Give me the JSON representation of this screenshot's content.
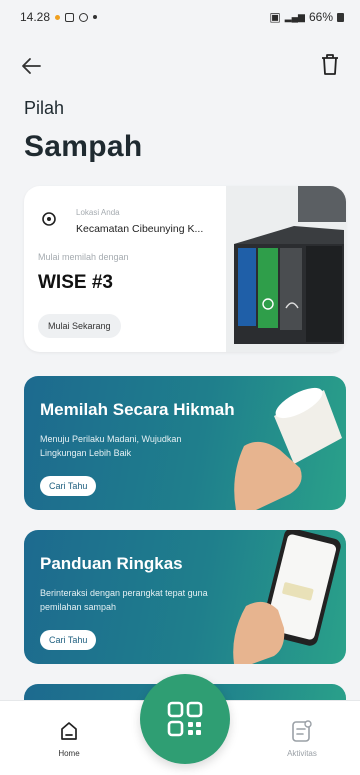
{
  "status_bar": {
    "time": "14.28",
    "battery": "66%"
  },
  "header": {
    "title_small": "Pilah",
    "title_large": "Sampah"
  },
  "location_card": {
    "location_label": "Lokasi Anda",
    "location_value": "Kecamatan Cibeunying K...",
    "start_label": "Mulai memilah dengan",
    "device_name": "WISE #3",
    "start_button": "Mulai Sekarang"
  },
  "banners": [
    {
      "title": "Memilah Secara Hikmah",
      "subtitle": "Menuju Perilaku Madani, Wujudkan Lingkungan Lebih Baik",
      "button": "Cari Tahu"
    },
    {
      "title": "Panduan Ringkas",
      "subtitle": "Berinteraksi dengan perangkat tepat guna pemilahan sampah",
      "button": "Cari Tahu"
    }
  ],
  "bottom_nav": {
    "home_label": "Home",
    "activity_label": "Aktivitas"
  },
  "colors": {
    "accent_green": "#2f9e73",
    "banner_blue": "#1d6a8f",
    "banner_teal": "#2aa18a"
  }
}
